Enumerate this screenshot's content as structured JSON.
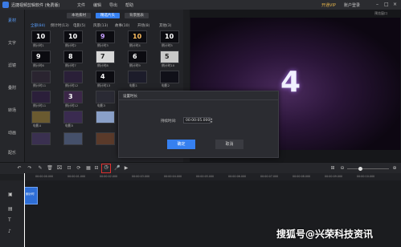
{
  "app": {
    "title": "迅捷视频剪辑软件 (免费版)",
    "menu": [
      "文件",
      "编辑",
      "导出",
      "帮助"
    ],
    "vip": "开通VIP",
    "login": "账户登录"
  },
  "sidebar": {
    "items": [
      "素材",
      "文字",
      "滤镜",
      "叠附",
      "转场",
      "动画",
      "配乐"
    ]
  },
  "library": {
    "top_buttons": [
      "本地素材",
      "精选片头",
      "背景图表"
    ],
    "categories": [
      "全部(84)",
      "倒计时(13)",
      "电影(5)",
      "风景(13)",
      "故事(10)",
      "开场(8)",
      "其他(3)"
    ],
    "thumbs": [
      "倒计时1",
      "倒计时2",
      "倒计时3",
      "倒计时4",
      "倒计时5",
      "倒计时6",
      "倒计时7",
      "倒计时8",
      "倒计时9",
      "倒计时10",
      "倒计时11",
      "倒计时12",
      "倒计时13",
      "电影1",
      "电影2",
      "电影3",
      "电影4",
      "电影5"
    ],
    "countdown_digits": [
      "10",
      "9",
      "8",
      "7",
      "6",
      "5",
      "4",
      "3"
    ]
  },
  "preview": {
    "label": "预览窗口",
    "digit": "4"
  },
  "timeline": {
    "ticks": [
      "00:00:00.000",
      "00:00:01.000",
      "00:00:02.000",
      "00:00:03.000",
      "00:00:04.000",
      "00:00:05.000",
      "00:00:06.000",
      "00:00:07.000",
      "00:00:08.000",
      "00:00:09.000",
      "00:00:10.000"
    ],
    "clip_label": "倒计时"
  },
  "dialog": {
    "title": "设置时长",
    "duration_label": "持续时间:",
    "duration_value": "00:00:05.000",
    "ok": "确定",
    "cancel": "取消"
  },
  "watermark": "搜狐号@兴荣科技资讯"
}
